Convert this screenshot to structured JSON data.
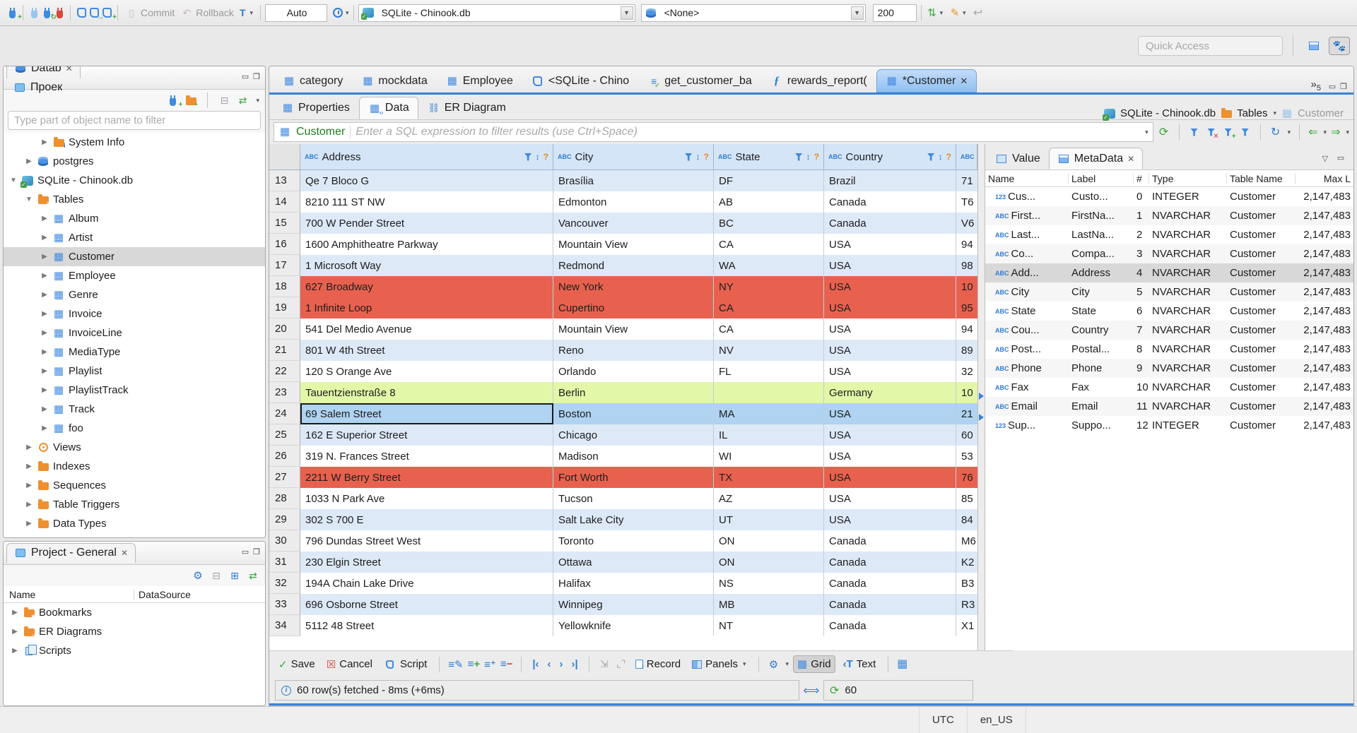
{
  "colors": {
    "accent": "#3b82d8",
    "row_error": "#e8614e",
    "row_new": "#e2f7a7",
    "row_selected": "#afd3f1",
    "row_stripe": "#dde9f7",
    "header_bg": "#d5e5f8",
    "table_icon_blue": "#3f8ae0",
    "folder_orange": "#ef8f2e"
  },
  "topbar": {
    "commit_label": "Commit",
    "rollback_label": "Rollback",
    "auto_label": "Auto",
    "connection_value": "SQLite - Chinook.db",
    "schema_value": "<None>",
    "fetch_size_value": "200",
    "quick_access_placeholder": "Quick Access"
  },
  "navigator": {
    "tabs": [
      {
        "label": "Datab",
        "icon": "database-stack-icon",
        "cls": "active",
        "closable": true
      },
      {
        "label": "Проек",
        "icon": "projects-icon",
        "cls": "",
        "closable": false
      }
    ],
    "filter_placeholder": "Type part of object name to filter",
    "tree": [
      {
        "label": "System Info",
        "icon": "system-info-folder-icon",
        "depth": 2,
        "arrow": "collapsed",
        "cls": ""
      },
      {
        "label": "postgres",
        "icon": "database-icon",
        "depth": 1,
        "arrow": "collapsed",
        "cls": ""
      },
      {
        "label": "SQLite - Chinook.db",
        "icon": "sqlite-connection-icon",
        "depth": 0,
        "arrow": "expanded",
        "cls": ""
      },
      {
        "label": "Tables",
        "icon": "tables-folder-icon",
        "depth": 1,
        "arrow": "expanded",
        "cls": ""
      },
      {
        "label": "Album",
        "icon": "table-icon",
        "depth": 2,
        "arrow": "collapsed",
        "cls": ""
      },
      {
        "label": "Artist",
        "icon": "table-icon",
        "depth": 2,
        "arrow": "collapsed",
        "cls": ""
      },
      {
        "label": "Customer",
        "icon": "table-icon",
        "depth": 2,
        "arrow": "collapsed",
        "cls": "selected"
      },
      {
        "label": "Employee",
        "icon": "table-icon",
        "depth": 2,
        "arrow": "collapsed",
        "cls": ""
      },
      {
        "label": "Genre",
        "icon": "table-icon",
        "depth": 2,
        "arrow": "collapsed",
        "cls": ""
      },
      {
        "label": "Invoice",
        "icon": "table-icon",
        "depth": 2,
        "arrow": "collapsed",
        "cls": ""
      },
      {
        "label": "InvoiceLine",
        "icon": "table-icon",
        "depth": 2,
        "arrow": "collapsed",
        "cls": ""
      },
      {
        "label": "MediaType",
        "icon": "table-icon",
        "depth": 2,
        "arrow": "collapsed",
        "cls": ""
      },
      {
        "label": "Playlist",
        "icon": "table-icon",
        "depth": 2,
        "arrow": "collapsed",
        "cls": ""
      },
      {
        "label": "PlaylistTrack",
        "icon": "table-icon",
        "depth": 2,
        "arrow": "collapsed",
        "cls": ""
      },
      {
        "label": "Track",
        "icon": "table-icon",
        "depth": 2,
        "arrow": "collapsed",
        "cls": ""
      },
      {
        "label": "foo",
        "icon": "table-icon",
        "depth": 2,
        "arrow": "collapsed",
        "cls": ""
      },
      {
        "label": "Views",
        "icon": "views-folder-icon",
        "depth": 1,
        "arrow": "collapsed",
        "cls": ""
      },
      {
        "label": "Indexes",
        "icon": "folder-icon",
        "depth": 1,
        "arrow": "collapsed",
        "cls": ""
      },
      {
        "label": "Sequences",
        "icon": "folder-icon",
        "depth": 1,
        "arrow": "collapsed",
        "cls": ""
      },
      {
        "label": "Table Triggers",
        "icon": "folder-icon",
        "depth": 1,
        "arrow": "collapsed",
        "cls": ""
      },
      {
        "label": "Data Types",
        "icon": "folder-icon",
        "depth": 1,
        "arrow": "collapsed",
        "cls": ""
      }
    ]
  },
  "project_panel": {
    "title": "Project - General",
    "columns": {
      "name": "Name",
      "datasource": "DataSource"
    },
    "items": [
      {
        "label": "Bookmarks",
        "icon": "bookmarks-folder-icon",
        "arrow": "collapsed"
      },
      {
        "label": "ER Diagrams",
        "icon": "er-diagrams-folder-icon",
        "arrow": "collapsed"
      },
      {
        "label": "Scripts",
        "icon": "scripts-folder-icon",
        "arrow": "collapsed"
      }
    ]
  },
  "editor": {
    "tabs": [
      {
        "label": "category",
        "icon": "table-icon",
        "cls": "",
        "closable": false
      },
      {
        "label": "mockdata",
        "icon": "table-icon",
        "cls": "",
        "closable": false
      },
      {
        "label": "Employee",
        "icon": "table-icon",
        "cls": "",
        "closable": false
      },
      {
        "label": "<SQLite - Chino",
        "icon": "sql-editor-icon",
        "cls": "",
        "closable": false
      },
      {
        "label": "get_customer_ba",
        "icon": "script-check-icon",
        "cls": "",
        "closable": false
      },
      {
        "label": "rewards_report(",
        "icon": "function-icon",
        "cls": "",
        "closable": false
      },
      {
        "label": "*Customer",
        "icon": "table-icon",
        "cls": "active",
        "closable": true
      }
    ],
    "overflow_count": "5",
    "subtabs": [
      {
        "label": "Properties",
        "icon": "properties-tab-icon",
        "cls": ""
      },
      {
        "label": "Data",
        "icon": "data-tab-icon",
        "cls": "active"
      },
      {
        "label": "ER Diagram",
        "icon": "er-diagram-tab-icon",
        "cls": ""
      }
    ],
    "breadcrumb": {
      "connection": "SQLite - Chinook.db",
      "group": "Tables",
      "table": "Customer"
    },
    "filter": {
      "table_label": "Customer",
      "placeholder": "Enter a SQL expression to filter results (use Ctrl+Space)"
    },
    "grid": {
      "columns": [
        {
          "label": "Address"
        },
        {
          "label": "City"
        },
        {
          "label": "State"
        },
        {
          "label": "Country"
        }
      ],
      "rows": [
        {
          "num": "13",
          "address": "Qe 7 Bloco G",
          "city": "Brasília",
          "region": "DF",
          "country": "Brazil",
          "postal": "71",
          "cls": "stripe"
        },
        {
          "num": "14",
          "address": "8210 111 ST NW",
          "city": "Edmonton",
          "region": "AB",
          "country": "Canada",
          "postal": "T6",
          "cls": ""
        },
        {
          "num": "15",
          "address": "700 W Pender Street",
          "city": "Vancouver",
          "region": "BC",
          "country": "Canada",
          "postal": "V6",
          "cls": "stripe"
        },
        {
          "num": "16",
          "address": "1600 Amphitheatre Parkway",
          "city": "Mountain View",
          "region": "CA",
          "country": "USA",
          "postal": "94",
          "cls": ""
        },
        {
          "num": "17",
          "address": "1 Microsoft Way",
          "city": "Redmond",
          "region": "WA",
          "country": "USA",
          "postal": "98",
          "cls": "stripe"
        },
        {
          "num": "18",
          "address": "627 Broadway",
          "city": "New York",
          "region": "NY",
          "country": "USA",
          "postal": "10",
          "cls": "error"
        },
        {
          "num": "19",
          "address": "1 Infinite Loop",
          "city": "Cupertino",
          "region": "CA",
          "country": "USA",
          "postal": "95",
          "cls": "error"
        },
        {
          "num": "20",
          "address": "541 Del Medio Avenue",
          "city": "Mountain View",
          "region": "CA",
          "country": "USA",
          "postal": "94",
          "cls": ""
        },
        {
          "num": "21",
          "address": "801 W 4th Street",
          "city": "Reno",
          "region": "NV",
          "country": "USA",
          "postal": "89",
          "cls": "stripe"
        },
        {
          "num": "22",
          "address": "120 S Orange Ave",
          "city": "Orlando",
          "region": "FL",
          "country": "USA",
          "postal": "32",
          "cls": ""
        },
        {
          "num": "23",
          "address": "Tauentzienstraße 8",
          "city": "Berlin",
          "region": "",
          "country": "Germany",
          "postal": "10",
          "cls": "new"
        },
        {
          "num": "24",
          "address": "69 Salem Street",
          "city": "Boston",
          "region": "MA",
          "country": "USA",
          "postal": "21",
          "cls": "selected"
        },
        {
          "num": "25",
          "address": "162 E Superior Street",
          "city": "Chicago",
          "region": "IL",
          "country": "USA",
          "postal": "60",
          "cls": "stripe"
        },
        {
          "num": "26",
          "address": "319 N. Frances Street",
          "city": "Madison",
          "region": "WI",
          "country": "USA",
          "postal": "53",
          "cls": ""
        },
        {
          "num": "27",
          "address": "2211 W Berry Street",
          "city": "Fort Worth",
          "region": "TX",
          "country": "USA",
          "postal": "76",
          "cls": "error"
        },
        {
          "num": "28",
          "address": "1033 N Park Ave",
          "city": "Tucson",
          "region": "AZ",
          "country": "USA",
          "postal": "85",
          "cls": ""
        },
        {
          "num": "29",
          "address": "302 S 700 E",
          "city": "Salt Lake City",
          "region": "UT",
          "country": "USA",
          "postal": "84",
          "cls": "stripe"
        },
        {
          "num": "30",
          "address": "796 Dundas Street West",
          "city": "Toronto",
          "region": "ON",
          "country": "Canada",
          "postal": "M6",
          "cls": ""
        },
        {
          "num": "31",
          "address": "230 Elgin Street",
          "city": "Ottawa",
          "region": "ON",
          "country": "Canada",
          "postal": "K2",
          "cls": "stripe"
        },
        {
          "num": "32",
          "address": "194A Chain Lake Drive",
          "city": "Halifax",
          "region": "NS",
          "country": "Canada",
          "postal": "B3",
          "cls": ""
        },
        {
          "num": "33",
          "address": "696 Osborne Street",
          "city": "Winnipeg",
          "region": "MB",
          "country": "Canada",
          "postal": "R3",
          "cls": "stripe"
        },
        {
          "num": "34",
          "address": "5112 48 Street",
          "city": "Yellowknife",
          "region": "NT",
          "country": "Canada",
          "postal": "X1",
          "cls": ""
        }
      ]
    },
    "meta": {
      "tabs": [
        {
          "label": "Value",
          "icon": "value-panel-icon",
          "cls": "",
          "closable": false
        },
        {
          "label": "MetaData",
          "icon": "metadata-panel-icon",
          "cls": "active",
          "closable": true
        }
      ],
      "columns": {
        "name": "Name",
        "label": "Label",
        "ord": "#",
        "type": "Type",
        "table": "Table Name",
        "max": "Max L"
      },
      "rows": [
        {
          "icon": "123",
          "name": "Cus...",
          "label": "Custo...",
          "ord": "0",
          "type": "INTEGER",
          "table": "Customer",
          "max": "2,147,483",
          "cls": ""
        },
        {
          "icon": "ABC",
          "name": "First...",
          "label": "FirstNa...",
          "ord": "1",
          "type": "NVARCHAR",
          "table": "Customer",
          "max": "2,147,483",
          "cls": ""
        },
        {
          "icon": "ABC",
          "name": "Last...",
          "label": "LastNa...",
          "ord": "2",
          "type": "NVARCHAR",
          "table": "Customer",
          "max": "2,147,483",
          "cls": ""
        },
        {
          "icon": "ABC",
          "name": "Co...",
          "label": "Compa...",
          "ord": "3",
          "type": "NVARCHAR",
          "table": "Customer",
          "max": "2,147,483",
          "cls": ""
        },
        {
          "icon": "ABC",
          "name": "Add...",
          "label": "Address",
          "ord": "4",
          "type": "NVARCHAR",
          "table": "Customer",
          "max": "2,147,483",
          "cls": "selected"
        },
        {
          "icon": "ABC",
          "name": "City",
          "label": "City",
          "ord": "5",
          "type": "NVARCHAR",
          "table": "Customer",
          "max": "2,147,483",
          "cls": ""
        },
        {
          "icon": "ABC",
          "name": "State",
          "label": "State",
          "ord": "6",
          "type": "NVARCHAR",
          "table": "Customer",
          "max": "2,147,483",
          "cls": ""
        },
        {
          "icon": "ABC",
          "name": "Cou...",
          "label": "Country",
          "ord": "7",
          "type": "NVARCHAR",
          "table": "Customer",
          "max": "2,147,483",
          "cls": ""
        },
        {
          "icon": "ABC",
          "name": "Post...",
          "label": "Postal...",
          "ord": "8",
          "type": "NVARCHAR",
          "table": "Customer",
          "max": "2,147,483",
          "cls": ""
        },
        {
          "icon": "ABC",
          "name": "Phone",
          "label": "Phone",
          "ord": "9",
          "type": "NVARCHAR",
          "table": "Customer",
          "max": "2,147,483",
          "cls": ""
        },
        {
          "icon": "ABC",
          "name": "Fax",
          "label": "Fax",
          "ord": "10",
          "type": "NVARCHAR",
          "table": "Customer",
          "max": "2,147,483",
          "cls": ""
        },
        {
          "icon": "ABC",
          "name": "Email",
          "label": "Email",
          "ord": "11",
          "type": "NVARCHAR",
          "table": "Customer",
          "max": "2,147,483",
          "cls": ""
        },
        {
          "icon": "123",
          "name": "Sup...",
          "label": "Suppo...",
          "ord": "12",
          "type": "INTEGER",
          "table": "Customer",
          "max": "2,147,483",
          "cls": ""
        }
      ]
    },
    "result_toolbar": {
      "save": "Save",
      "cancel": "Cancel",
      "script": "Script",
      "record": "Record",
      "panels": "Panels",
      "grid": "Grid",
      "text": "Text"
    },
    "status": {
      "message": "60 row(s) fetched - 8ms (+6ms)",
      "refresh_value": "60"
    }
  },
  "statusbar": {
    "timezone": "UTC",
    "locale": "en_US"
  }
}
